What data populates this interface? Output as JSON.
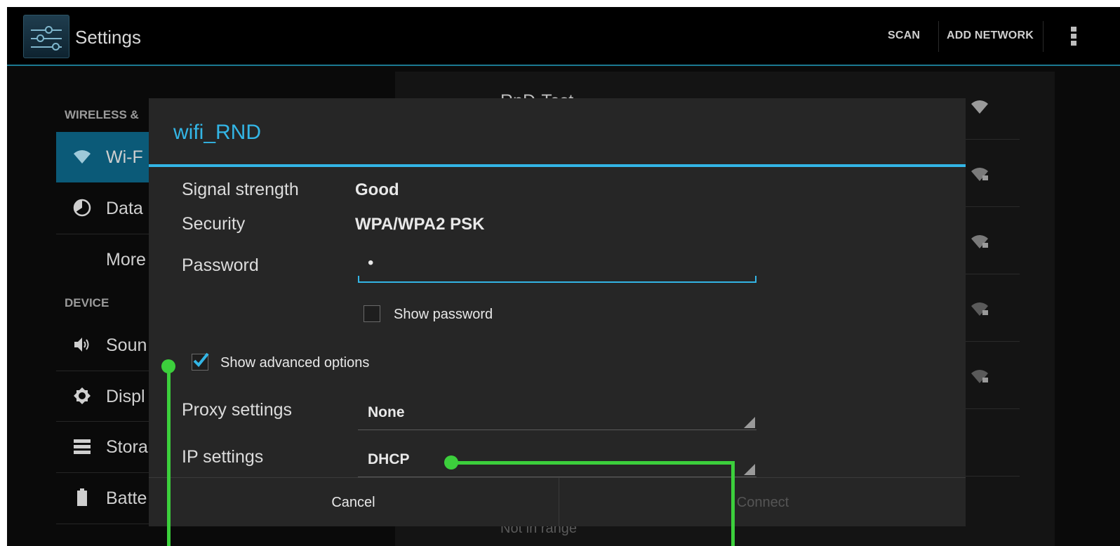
{
  "action_bar": {
    "title": "Settings",
    "scan_label": "SCAN",
    "add_network_label": "ADD NETWORK",
    "app_icon": "settings-sliders-icon",
    "overflow_icon": "overflow-menu-icon"
  },
  "left_pane": {
    "header_wireless": "WIRELESS &",
    "header_device": "DEVICE",
    "items": [
      {
        "label": "Wi-F",
        "icon": "wifi-icon",
        "selected": true
      },
      {
        "label": "Data",
        "icon": "data-usage-icon"
      },
      {
        "label": "More",
        "icon": ""
      },
      {
        "label": "Soun",
        "icon": "sound-icon"
      },
      {
        "label": "Displ",
        "icon": "display-icon"
      },
      {
        "label": "Stora",
        "icon": "storage-icon"
      },
      {
        "label": "Batte",
        "icon": "battery-icon"
      }
    ]
  },
  "right_pane": {
    "first_network": "RnD-Test",
    "not_in_range": "Not in range"
  },
  "dialog": {
    "title": "wifi_RND",
    "signal_label": "Signal strength",
    "signal_value": "Good",
    "security_label": "Security",
    "security_value": "WPA/WPA2 PSK",
    "password_label": "Password",
    "password_value": "•",
    "show_password_label": "Show password",
    "show_password_checked": false,
    "show_advanced_label": "Show advanced options",
    "show_advanced_checked": true,
    "proxy_label": "Proxy settings",
    "proxy_value": "None",
    "ip_label": "IP settings",
    "ip_value": "DHCP",
    "cancel_label": "Cancel",
    "connect_label": "Connect"
  },
  "colors": {
    "accent": "#33b5e5",
    "selected_bg": "#0b5a78",
    "annotation": "#3ccf3c"
  }
}
